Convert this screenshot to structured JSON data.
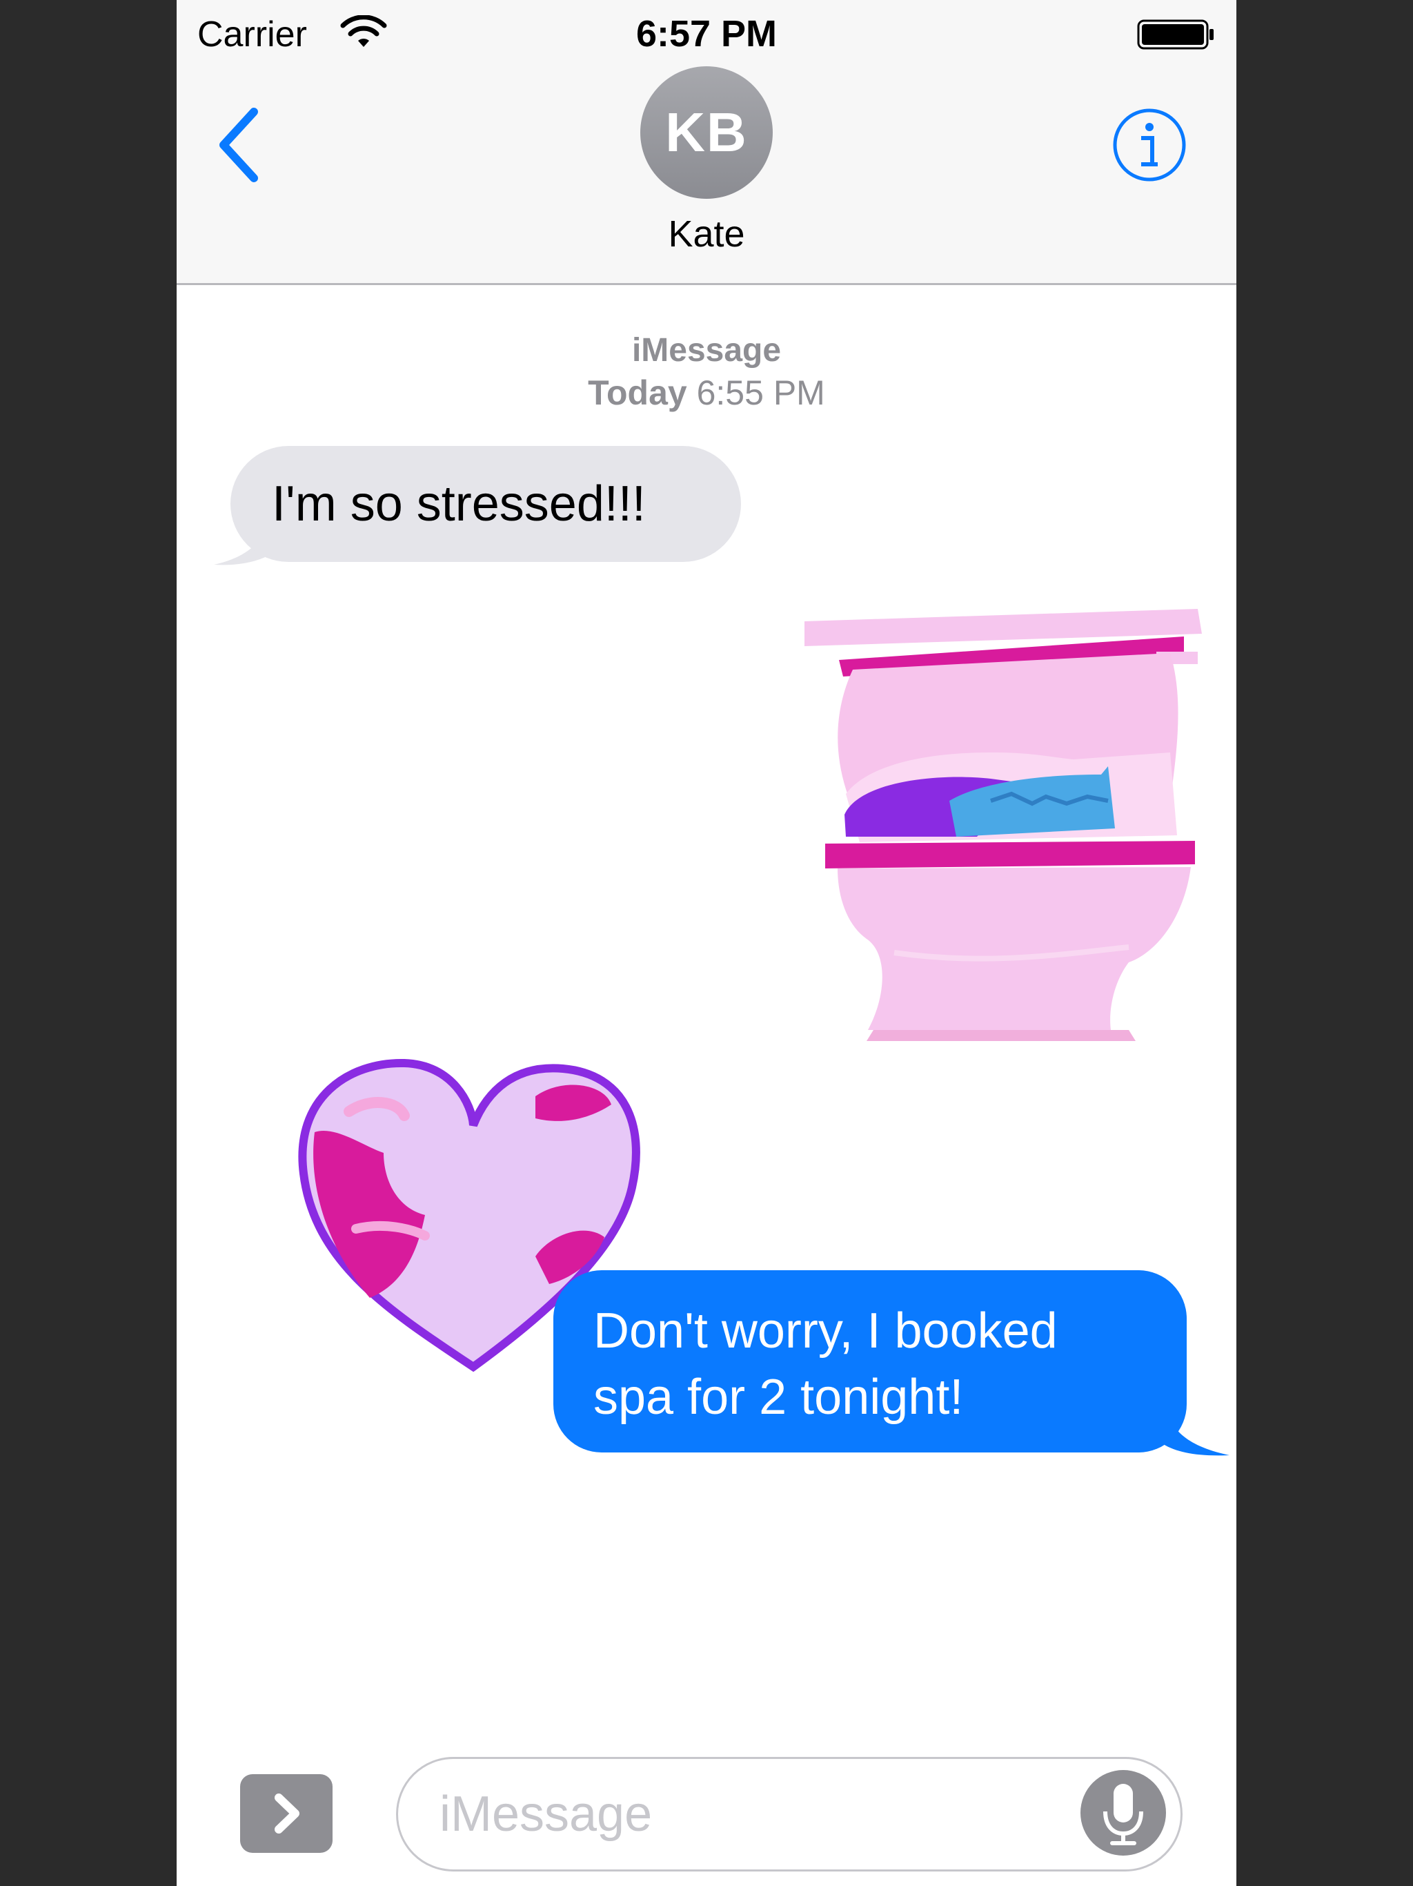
{
  "status_bar": {
    "carrier": "Carrier",
    "time": "6:57 PM"
  },
  "header": {
    "avatar_initials": "KB",
    "contact_name": "Kate"
  },
  "conversation": {
    "service": "iMessage",
    "timestamp_day": "Today",
    "timestamp_time": "6:55 PM",
    "messages": [
      {
        "direction": "incoming",
        "text": "I'm so stressed!!!"
      },
      {
        "direction": "outgoing",
        "text": "Don't worry, I booked spa for 2 tonight!"
      }
    ]
  },
  "input_bar": {
    "placeholder": "iMessage"
  },
  "colors": {
    "accent": "#0a7aff",
    "incoming_bubble": "#e5e5ea",
    "gray": "#8e8e93"
  }
}
